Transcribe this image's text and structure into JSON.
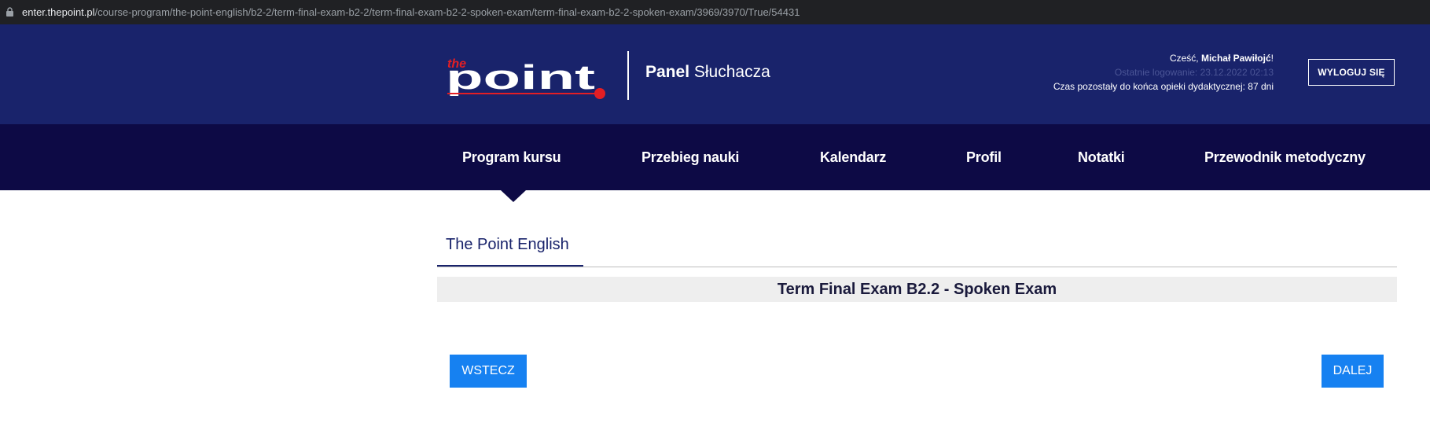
{
  "browser": {
    "url_domain": "enter.thepoint.pl",
    "url_path": "/course-program/the-point-english/b2-2/term-final-exam-b2-2/term-final-exam-b2-2-spoken-exam/term-final-exam-b2-2-spoken-exam/3969/3970/True/54431"
  },
  "header": {
    "logo_small": "the",
    "logo_main": "point",
    "panel_bold": "Panel",
    "panel_rest": " Słuchacza",
    "greeting_prefix": "Cześć, ",
    "user_name": "Michał Pawiłojć",
    "greeting_suffix": "!",
    "last_login": "Ostatnie logowanie: 23.12.2022 02:13",
    "remaining_time": "Czas pozostały do końca opieki dydaktycznej: 87 dni",
    "logout_label": "WYLOGUJ SIĘ"
  },
  "nav": {
    "items": [
      {
        "label": "Program kursu"
      },
      {
        "label": "Przebieg nauki"
      },
      {
        "label": "Kalendarz"
      },
      {
        "label": "Profil"
      },
      {
        "label": "Notatki"
      },
      {
        "label": "Przewodnik metodyczny"
      }
    ],
    "active_index": 0
  },
  "content": {
    "tab_label": "The Point English",
    "exam_title": "Term Final Exam B2.2 - Spoken Exam",
    "back_label": "WSTECZ",
    "next_label": "DALEJ"
  },
  "colors": {
    "header_bg": "#19236b",
    "nav_bg": "#0d0a45",
    "button_blue": "#1681f1",
    "logo_red": "#e31e24"
  }
}
